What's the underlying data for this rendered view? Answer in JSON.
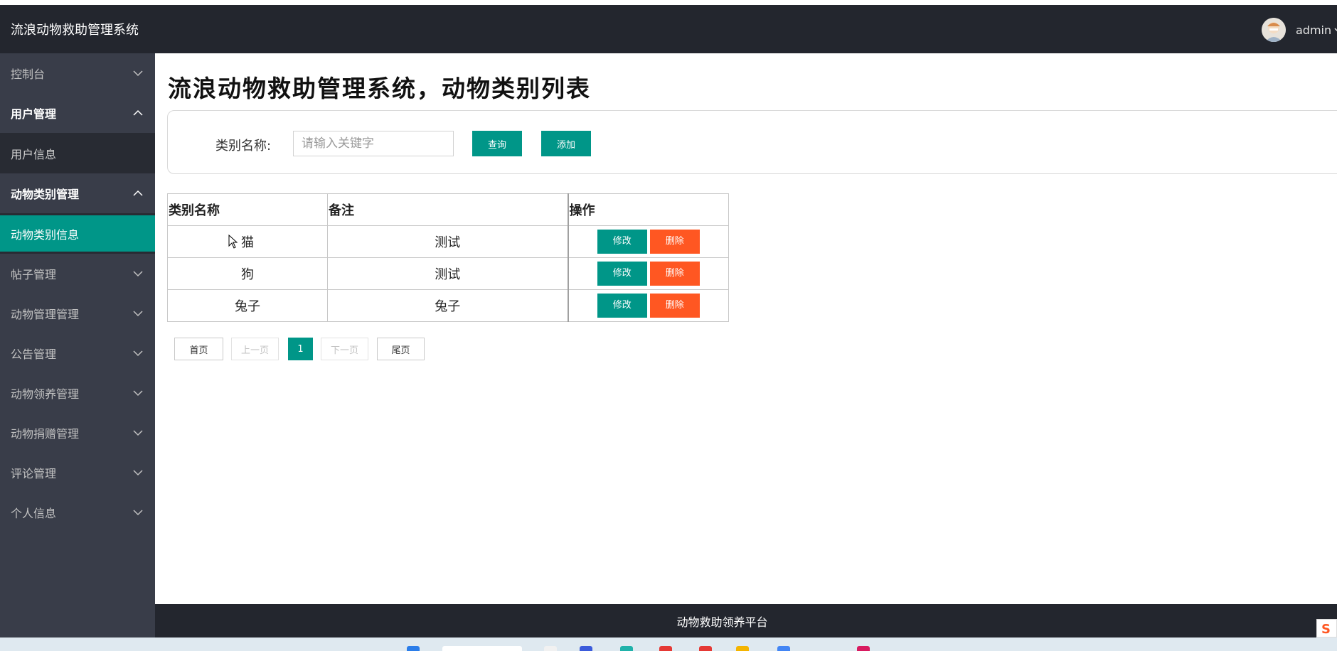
{
  "app": {
    "brand": "流浪动物救助管理系统",
    "user_name": "admin"
  },
  "sidebar": {
    "items": [
      {
        "label": "控制台",
        "expanded": false
      },
      {
        "label": "用户管理",
        "expanded": true,
        "children": [
          {
            "label": "用户信息",
            "active": false
          }
        ]
      },
      {
        "label": "动物类别管理",
        "expanded": true,
        "children": [
          {
            "label": "动物类别信息",
            "active": true
          }
        ]
      },
      {
        "label": "帖子管理",
        "expanded": false
      },
      {
        "label": "动物管理管理",
        "expanded": false
      },
      {
        "label": "公告管理",
        "expanded": false
      },
      {
        "label": "动物领养管理",
        "expanded": false
      },
      {
        "label": "动物捐赠管理",
        "expanded": false
      },
      {
        "label": "评论管理",
        "expanded": false
      },
      {
        "label": "个人信息",
        "expanded": false
      }
    ]
  },
  "main": {
    "title": "流浪动物救助管理系统，动物类别列表",
    "search": {
      "label": "类别名称:",
      "placeholder": "请输入关键字",
      "value": "",
      "query_label": "查询",
      "add_label": "添加"
    },
    "table": {
      "columns": [
        "类别名称",
        "备注",
        "操作"
      ],
      "rows": [
        {
          "name": "猫",
          "note": "测试"
        },
        {
          "name": "狗",
          "note": "测试"
        },
        {
          "name": "兔子",
          "note": "兔子"
        }
      ],
      "edit_label": "修改",
      "delete_label": "删除"
    },
    "pagination": {
      "first": "首页",
      "prev": "上一页",
      "current": "1",
      "next": "下一页",
      "last": "尾页"
    }
  },
  "footer": {
    "text": "动物救助领养平台"
  },
  "colors": {
    "primary": "#009688",
    "danger": "#ff5722",
    "sidebar_bg": "#393d49",
    "header_bg": "#23262e"
  }
}
